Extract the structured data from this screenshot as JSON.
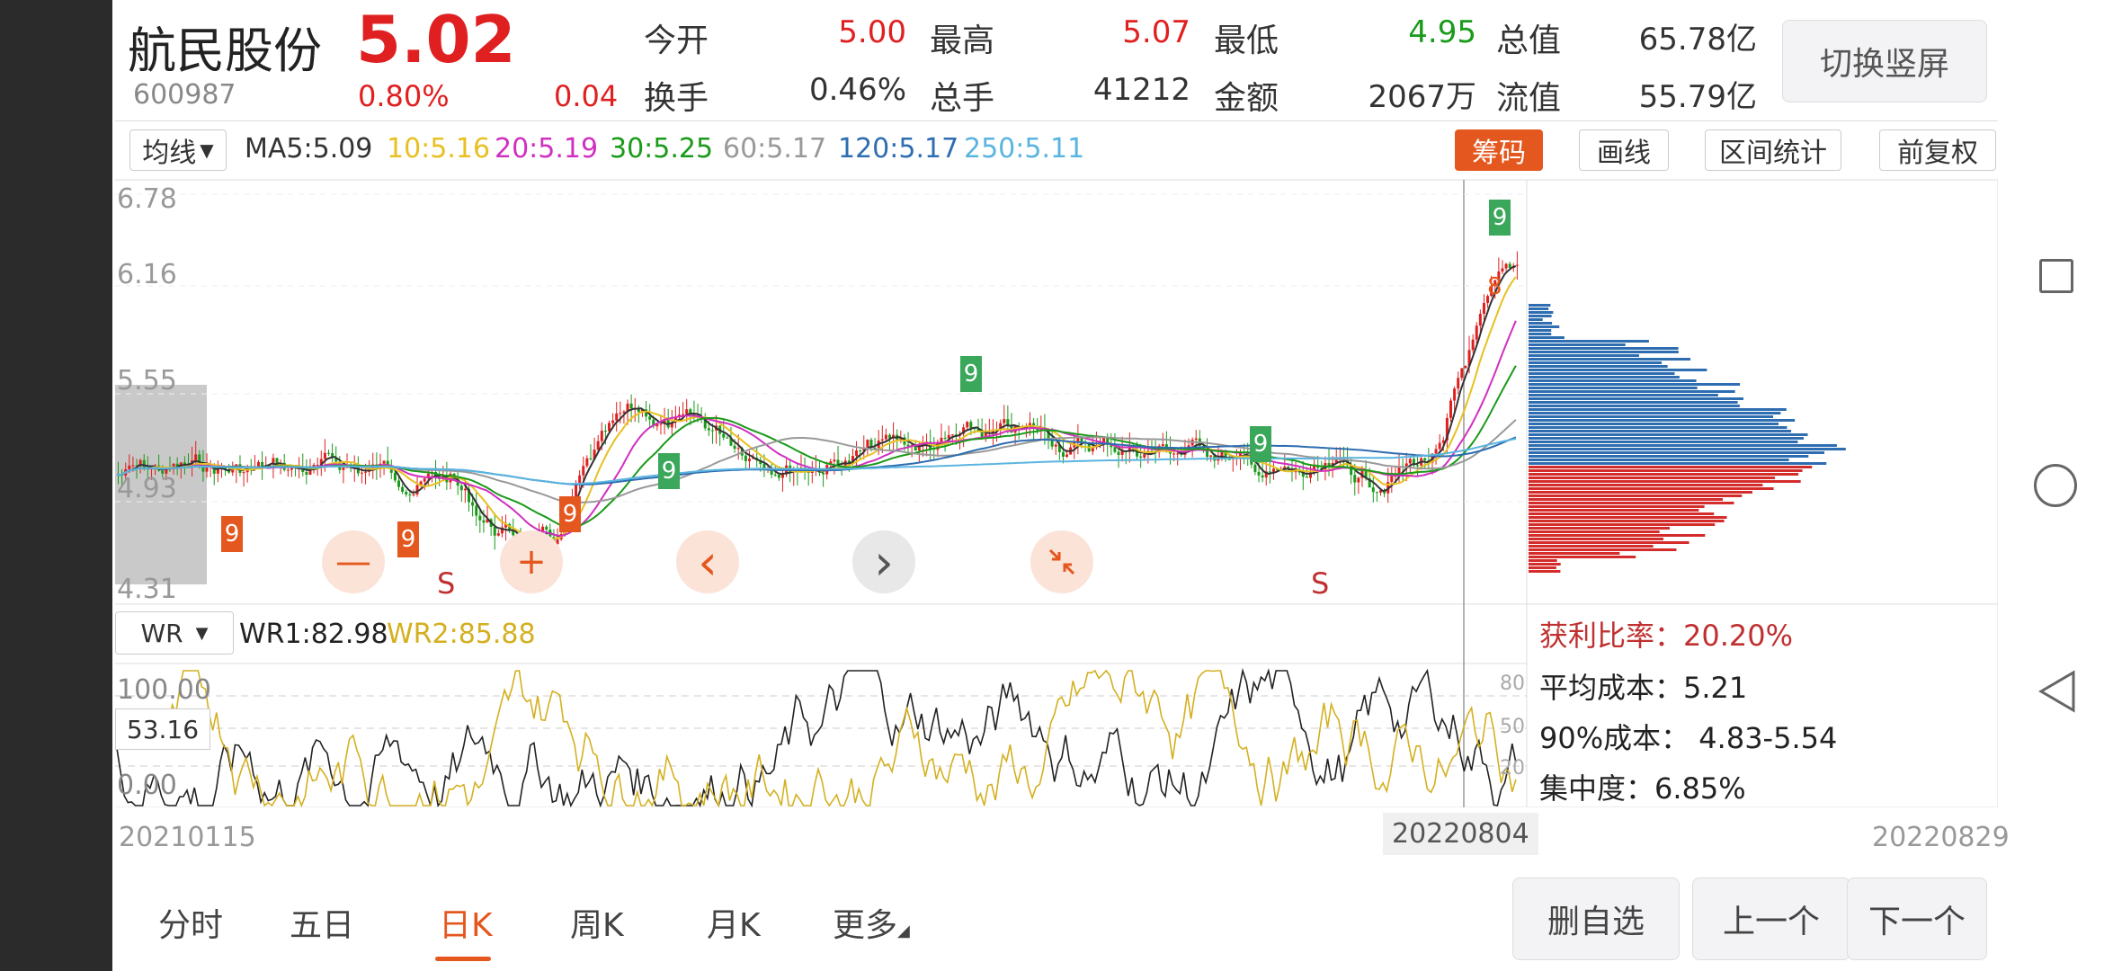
{
  "header": {
    "name": "航民股份",
    "price": "5.02",
    "code": "600987",
    "change_pct": "0.80%",
    "change": "0.04",
    "switch_button": "切换竖屏"
  },
  "quotes": [
    {
      "label": "今开",
      "value": "5.00",
      "color": "red"
    },
    {
      "label": "最高",
      "value": "5.07",
      "color": "red"
    },
    {
      "label": "最低",
      "value": "4.95",
      "color": "green"
    },
    {
      "label": "总值",
      "value": "65.78亿",
      "color": "dark"
    },
    {
      "label": "换手",
      "value": "0.46%",
      "color": "dark"
    },
    {
      "label": "总手",
      "value": "41212",
      "color": "dark"
    },
    {
      "label": "金额",
      "value": "2067万",
      "color": "dark"
    },
    {
      "label": "流值",
      "value": "55.79亿",
      "color": "dark"
    }
  ],
  "ma_bar": {
    "dropdown": "均线",
    "items": [
      {
        "text": "MA5:5.09",
        "color": "#333333"
      },
      {
        "text": "10:5.16",
        "color": "#e8c020"
      },
      {
        "text": "20:5.19",
        "color": "#d030c0"
      },
      {
        "text": "30:5.25",
        "color": "#1a9a1a"
      },
      {
        "text": "60:5.17",
        "color": "#999999"
      },
      {
        "text": "120:5.17",
        "color": "#2d6db0"
      },
      {
        "text": "250:5.11",
        "color": "#5ab4e0"
      }
    ],
    "tools": [
      "筹码",
      "画线",
      "区间统计",
      "前复权"
    ]
  },
  "price_axis": [
    "6.78",
    "6.16",
    "5.55",
    "4.93",
    "4.31"
  ],
  "overlay": {
    "minus": "—",
    "plus": "+",
    "left": "‹",
    "right": "›",
    "s_marks": [
      "S",
      "S"
    ],
    "nine_marks": [
      "9",
      "9",
      "9",
      "9",
      "9",
      "9",
      "9"
    ],
    "eight_mark": "8"
  },
  "wr": {
    "dropdown": "WR",
    "wr1": "WR1:82.98",
    "wr2": "WR2:85.88",
    "axis": [
      "100.00",
      "53.16",
      "0.00"
    ],
    "right_axis": [
      "80",
      "50",
      "20"
    ],
    "wr1_color": "#222222",
    "wr2_color": "#d4b020"
  },
  "chips": {
    "profit_ratio": "获利比率：20.20%",
    "avg_cost": "平均成本：5.21",
    "cost_90": "90%成本：  4.83-5.54",
    "concentration": "集中度：6.85%"
  },
  "dates": {
    "start": "20210115",
    "cursor": "20220804",
    "end": "20220829"
  },
  "tabs": [
    "分时",
    "五日",
    "日K",
    "周K",
    "月K",
    "更多"
  ],
  "active_tab": "日K",
  "bottom_buttons": [
    "删自选",
    "上一个",
    "下一个"
  ]
}
